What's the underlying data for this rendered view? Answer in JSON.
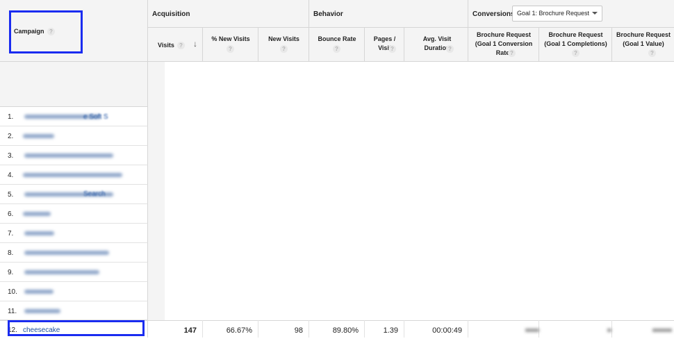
{
  "header": {
    "campaign_label": "Campaign",
    "acquisition_label": "Acquisition",
    "behavior_label": "Behavior",
    "conversions_label": "Conversions",
    "goal_select": "Goal 1: Brochure Request",
    "columns": [
      "Visits",
      "% New Visits",
      "New Visits",
      "Bounce Rate",
      "Pages / Visit",
      "Avg. Visit Duration",
      "Brochure Request (Goal 1 Conversion Rate)",
      "Brochure Request (Goal 1 Completions)",
      "Brochure Request (Goal 1 Value)"
    ]
  },
  "rows": [
    {
      "num": "1.",
      "name": "",
      "partial": "e Soft S"
    },
    {
      "num": "2.",
      "name": ""
    },
    {
      "num": "3.",
      "name": ""
    },
    {
      "num": "4.",
      "name": ""
    },
    {
      "num": "5.",
      "name": "",
      "partial": "Search"
    },
    {
      "num": "6.",
      "name": ""
    },
    {
      "num": "7.",
      "name": ""
    },
    {
      "num": "8.",
      "name": ""
    },
    {
      "num": "9.",
      "name": ""
    },
    {
      "num": "10.",
      "name": ""
    },
    {
      "num": "11.",
      "name": ""
    }
  ],
  "highlight_row": {
    "num": "12.",
    "name": "cheesecake",
    "visits": "147",
    "pct_new_visits": "66.67%",
    "new_visits": "98",
    "bounce_rate": "89.80%",
    "pages_per_visit": "1.39",
    "avg_duration": "00:00:49"
  },
  "colors": {
    "highlight_box": "#1a2cf0",
    "link": "#1a4fa0",
    "header_bg": "#f4f4f4"
  }
}
